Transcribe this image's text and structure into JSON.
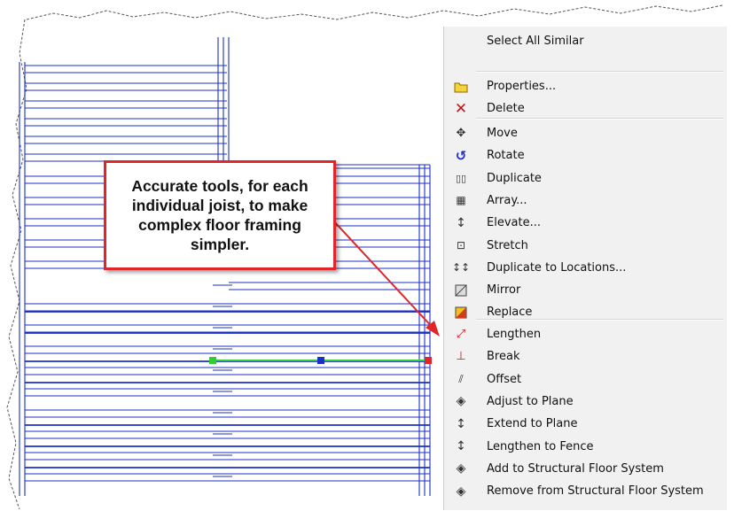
{
  "menu": {
    "groups": [
      {
        "items": [
          {
            "label": "Select All Similar",
            "icon": "none"
          }
        ]
      },
      {
        "items": [
          {
            "label": "Properties...",
            "icon": "folder-icon"
          },
          {
            "label": "Delete",
            "icon": "delete-x-icon"
          }
        ]
      },
      {
        "items": [
          {
            "label": "Move",
            "icon": "move-icon"
          },
          {
            "label": "Rotate",
            "icon": "rotate-icon"
          },
          {
            "label": "Duplicate",
            "icon": "duplicate-icon"
          },
          {
            "label": "Array...",
            "icon": "array-icon"
          },
          {
            "label": "Elevate...",
            "icon": "elevate-icon"
          },
          {
            "label": "Stretch",
            "icon": "stretch-icon"
          },
          {
            "label": "Duplicate to Locations...",
            "icon": "duplicate-locations-icon"
          },
          {
            "label": "Mirror",
            "icon": "mirror-icon"
          },
          {
            "label": "Replace",
            "icon": "replace-icon"
          }
        ]
      },
      {
        "items": [
          {
            "label": "Lengthen",
            "icon": "lengthen-icon"
          },
          {
            "label": "Break",
            "icon": "break-icon"
          },
          {
            "label": "Offset",
            "icon": "offset-icon"
          },
          {
            "label": "Adjust to Plane",
            "icon": "adjust-plane-icon"
          },
          {
            "label": "Extend to Plane",
            "icon": "extend-plane-icon"
          },
          {
            "label": "Lengthen to Fence",
            "icon": "lengthen-fence-icon"
          },
          {
            "label": "Add to Structural Floor System",
            "icon": "add-floor-system-icon"
          },
          {
            "label": "Remove from Structural Floor System",
            "icon": "remove-floor-system-icon"
          }
        ]
      }
    ]
  },
  "callout": {
    "text": "Accurate tools, for each individual joist, to make complex floor framing simpler."
  },
  "colors": {
    "joist_blue": "#1c2fc8",
    "selected_green": "#33cc33",
    "accent_red": "#e0262b",
    "menu_bg": "#f1f1f1"
  }
}
